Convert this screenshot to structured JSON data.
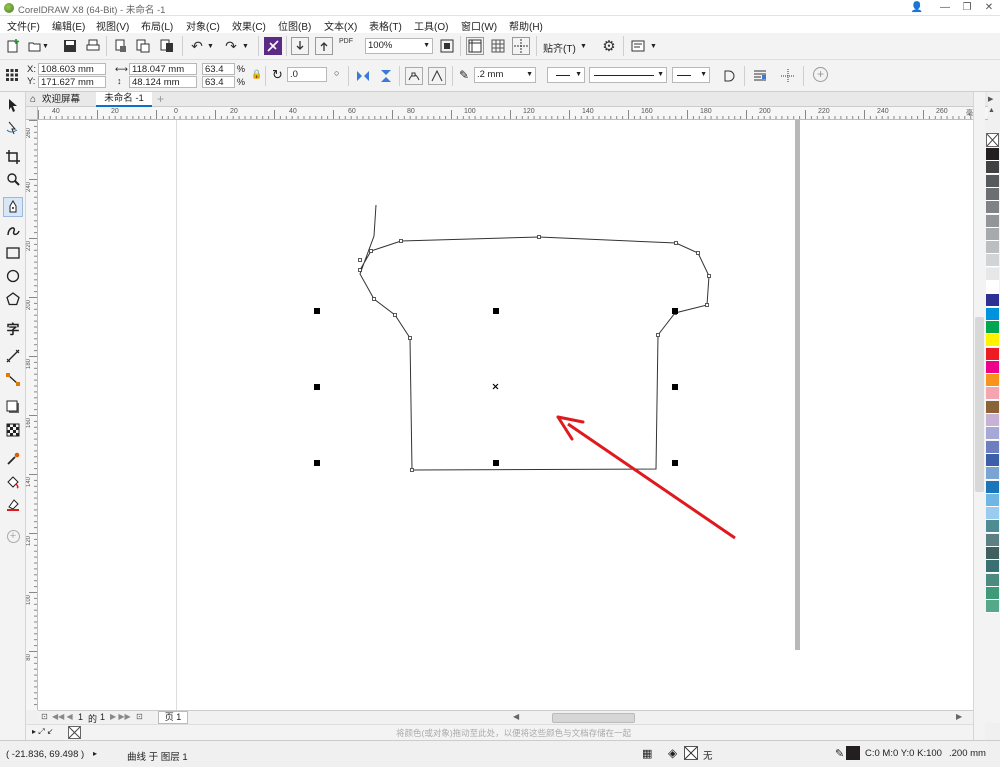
{
  "window": {
    "title": "CorelDRAW X8 (64-Bit) - 未命名 -1",
    "buttons": [
      "👤",
      "—",
      "❐",
      "✕"
    ]
  },
  "menu": [
    "文件(F)",
    "编辑(E)",
    "视图(V)",
    "布局(L)",
    "对象(C)",
    "效果(C)",
    "位图(B)",
    "文本(X)",
    "表格(T)",
    "工具(O)",
    "窗口(W)",
    "帮助(H)"
  ],
  "toolbar": {
    "zoom": "100%",
    "snap_label": "贴齐(T)",
    "pdf_label": "PDF"
  },
  "props": {
    "x": "108.603 mm",
    "y": "171.627 mm",
    "w": "118.047 mm",
    "h": "48.124 mm",
    "sx": "63.4",
    "sy": "63.4",
    "pct": "%",
    "rotate": ".0",
    "outline": ".2 mm"
  },
  "tabs": {
    "welcome": "欢迎屏幕",
    "doc": "未命名 -1",
    "add": "+"
  },
  "ruler": {
    "h_ticks": [
      {
        "v": "40"
      },
      {
        "v": "20"
      },
      {
        "v": "0"
      },
      {
        "v": "20"
      },
      {
        "v": "40"
      },
      {
        "v": "60"
      },
      {
        "v": "80"
      },
      {
        "v": "100"
      },
      {
        "v": "120"
      },
      {
        "v": "140"
      },
      {
        "v": "160"
      },
      {
        "v": "180"
      },
      {
        "v": "200"
      },
      {
        "v": "220"
      },
      {
        "v": "240"
      },
      {
        "v": "260"
      }
    ],
    "unit": "毫米",
    "v_ticks": [
      {
        "v": "260"
      },
      {
        "v": "240"
      },
      {
        "v": "220"
      },
      {
        "v": "200"
      },
      {
        "v": "180"
      },
      {
        "v": "160"
      },
      {
        "v": "140"
      },
      {
        "v": "120"
      },
      {
        "v": "100"
      },
      {
        "v": "80"
      }
    ]
  },
  "pagebar": {
    "current": "1",
    "of": "的",
    "total": "1",
    "page_tab": "页 1"
  },
  "colorbar_hint": "将颜色(或对象)拖动至此处，以便将这些颜色与文档存储在一起",
  "status": {
    "coords": "( -21.836, 69.498 )",
    "object": "曲线 于 图层 1",
    "fill_none": "无",
    "color_info": "C:0 M:0 Y:0 K:100",
    "outline_width": ".200 mm"
  },
  "colors": {
    "accent": "#0a73c9",
    "selection": "#000000",
    "arrow": "#e0191e",
    "palette": [
      "#231f20",
      "#414042",
      "#58595b",
      "#6d6e71",
      "#808285",
      "#939598",
      "#a7a9ac",
      "#bcbec0",
      "#d1d3d4",
      "#e6e7e8",
      "#ffffff",
      "#2e3192",
      "#0093dd",
      "#00a650",
      "#fff200",
      "#ed1c24",
      "#ec008c",
      "#f7941d",
      "#f4a6b0",
      "#8c6239",
      "#c7b2d6",
      "#a6a8d7",
      "#6d7fc0",
      "#3b5fa8",
      "#7ba4d3",
      "#1b75bb",
      "#6fb6e4",
      "#99ccee",
      "#4e8b93",
      "#5c7f84",
      "#3f5f61",
      "#3b7073",
      "#4c8c80",
      "#3f9a79",
      "#55a98a"
    ]
  }
}
